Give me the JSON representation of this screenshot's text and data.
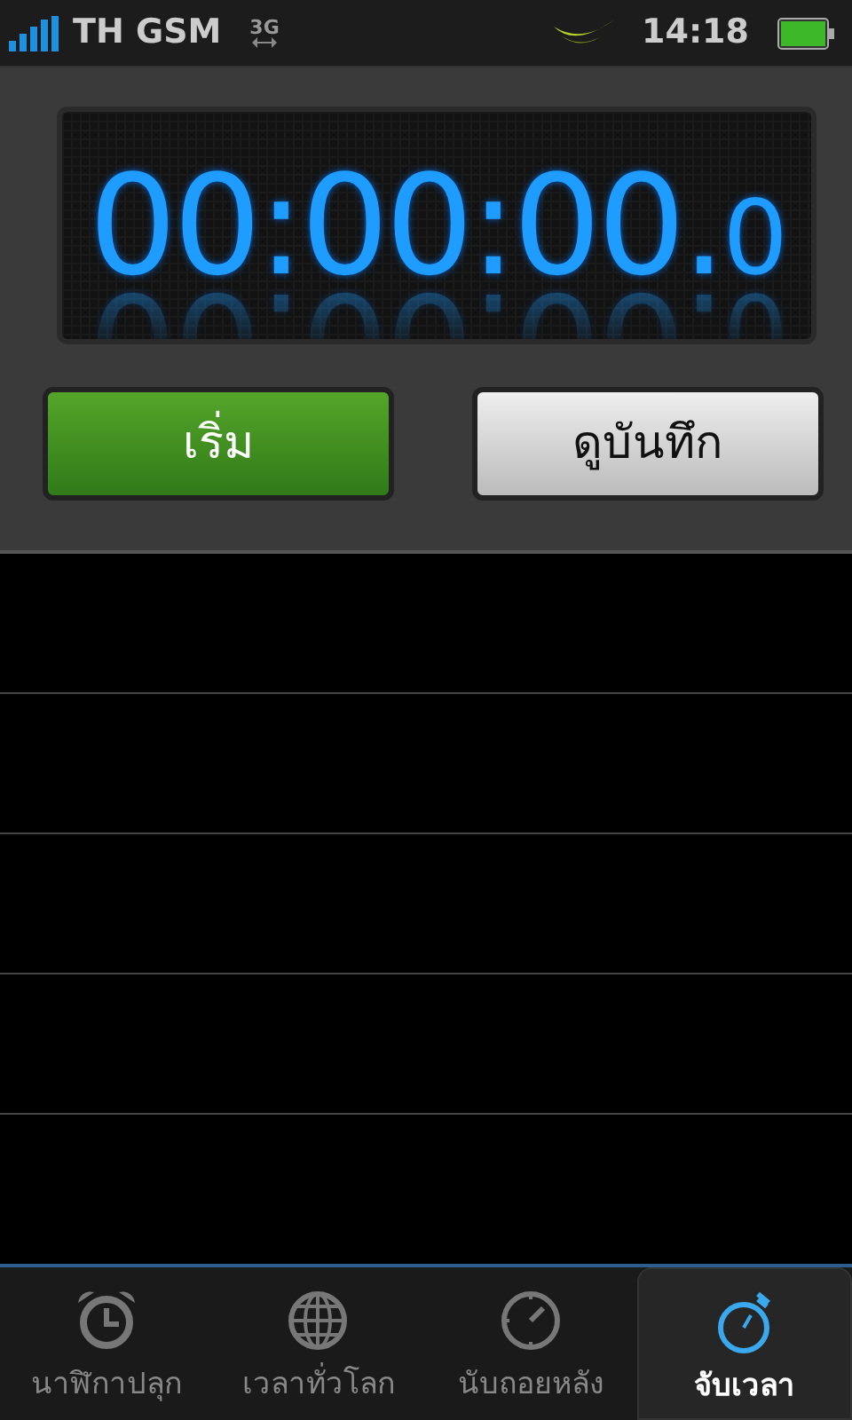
{
  "status_bar": {
    "carrier": "TH GSM",
    "network": "3G",
    "time": "14:18"
  },
  "stopwatch": {
    "time": "00:00:00.",
    "tenths": "0"
  },
  "buttons": [
    {
      "kind": "start",
      "label": "เริ่ม"
    },
    {
      "kind": "laps",
      "label": "ดูบันทึก"
    }
  ],
  "tabs": [
    {
      "kind": "alarm",
      "label": "นาฬิกาปลุก",
      "selected": false
    },
    {
      "kind": "world",
      "label": "เวลาทั่วโลก",
      "selected": false
    },
    {
      "kind": "timer",
      "label": "นับถอยหลัง",
      "selected": false
    },
    {
      "kind": "stopwatch",
      "label": "จับเวลา",
      "selected": true
    }
  ]
}
